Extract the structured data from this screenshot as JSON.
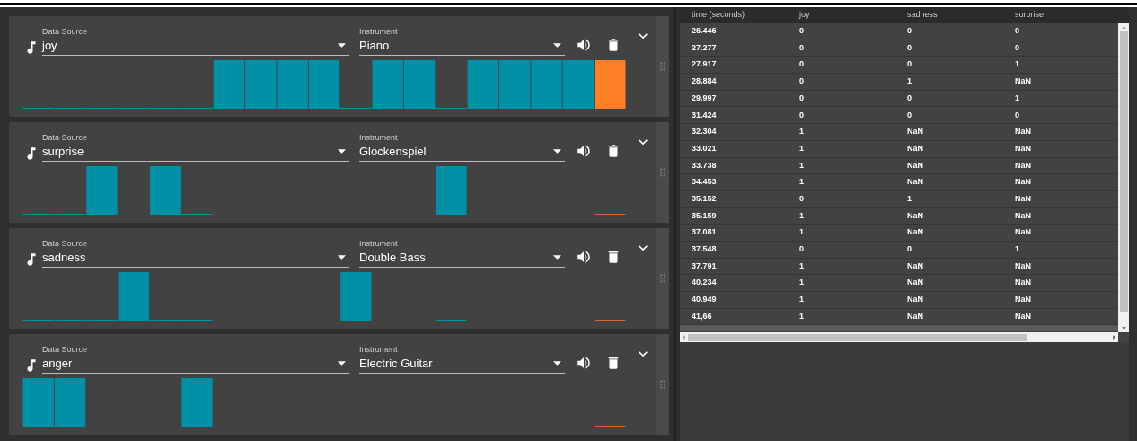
{
  "tracks": [
    {
      "data_source": {
        "label": "Data Source",
        "value": "joy"
      },
      "instrument": {
        "label": "Instrument",
        "value": "Piano"
      },
      "steps": [
        {
          "kind": "low"
        },
        {
          "kind": "low"
        },
        {
          "kind": "low"
        },
        {
          "kind": "low"
        },
        {
          "kind": "low"
        },
        {
          "kind": "low"
        },
        {
          "kind": "high"
        },
        {
          "kind": "high"
        },
        {
          "kind": "high"
        },
        {
          "kind": "high"
        },
        {
          "kind": "low"
        },
        {
          "kind": "high"
        },
        {
          "kind": "high"
        },
        {
          "kind": "low"
        },
        {
          "kind": "high"
        },
        {
          "kind": "high"
        },
        {
          "kind": "high"
        },
        {
          "kind": "high"
        },
        {
          "kind": "playhead-high"
        }
      ]
    },
    {
      "data_source": {
        "label": "Data Source",
        "value": "surprise"
      },
      "instrument": {
        "label": "Instrument",
        "value": "Glockenspiel"
      },
      "steps": [
        {
          "kind": "low"
        },
        {
          "kind": "low"
        },
        {
          "kind": "high"
        },
        {
          "kind": "empty"
        },
        {
          "kind": "high"
        },
        {
          "kind": "low"
        },
        {
          "kind": "empty"
        },
        {
          "kind": "empty"
        },
        {
          "kind": "empty"
        },
        {
          "kind": "empty"
        },
        {
          "kind": "empty"
        },
        {
          "kind": "empty"
        },
        {
          "kind": "empty"
        },
        {
          "kind": "high"
        },
        {
          "kind": "empty"
        },
        {
          "kind": "empty"
        },
        {
          "kind": "empty"
        },
        {
          "kind": "empty"
        },
        {
          "kind": "playhead-low"
        }
      ]
    },
    {
      "data_source": {
        "label": "Data Source",
        "value": "sadness"
      },
      "instrument": {
        "label": "Instrument",
        "value": "Double Bass"
      },
      "steps": [
        {
          "kind": "low"
        },
        {
          "kind": "low"
        },
        {
          "kind": "low"
        },
        {
          "kind": "high"
        },
        {
          "kind": "low"
        },
        {
          "kind": "low"
        },
        {
          "kind": "empty"
        },
        {
          "kind": "empty"
        },
        {
          "kind": "empty"
        },
        {
          "kind": "empty"
        },
        {
          "kind": "high"
        },
        {
          "kind": "empty"
        },
        {
          "kind": "empty"
        },
        {
          "kind": "low"
        },
        {
          "kind": "empty"
        },
        {
          "kind": "empty"
        },
        {
          "kind": "empty"
        },
        {
          "kind": "empty"
        },
        {
          "kind": "playhead-low"
        }
      ]
    },
    {
      "data_source": {
        "label": "Data Source",
        "value": "anger"
      },
      "instrument": {
        "label": "Instrument",
        "value": "Electric Guitar"
      },
      "steps": [
        {
          "kind": "high"
        },
        {
          "kind": "high"
        },
        {
          "kind": "empty"
        },
        {
          "kind": "empty"
        },
        {
          "kind": "empty"
        },
        {
          "kind": "high"
        },
        {
          "kind": "empty"
        },
        {
          "kind": "empty"
        },
        {
          "kind": "empty"
        },
        {
          "kind": "empty"
        },
        {
          "kind": "empty"
        },
        {
          "kind": "empty"
        },
        {
          "kind": "empty"
        },
        {
          "kind": "empty"
        },
        {
          "kind": "empty"
        },
        {
          "kind": "empty"
        },
        {
          "kind": "empty"
        },
        {
          "kind": "empty"
        },
        {
          "kind": "playhead-low"
        }
      ]
    }
  ],
  "table": {
    "columns": [
      "time (seconds)",
      "joy",
      "sadness",
      "surprise"
    ],
    "rows": [
      [
        "26.446",
        "0",
        "0",
        "0"
      ],
      [
        "27.277",
        "0",
        "0",
        "0"
      ],
      [
        "27.917",
        "0",
        "0",
        "1"
      ],
      [
        "28.884",
        "0",
        "1",
        "NaN"
      ],
      [
        "29.997",
        "0",
        "0",
        "1"
      ],
      [
        "31.424",
        "0",
        "0",
        "0"
      ],
      [
        "32.304",
        "1",
        "NaN",
        "NaN"
      ],
      [
        "33.021",
        "1",
        "NaN",
        "NaN"
      ],
      [
        "33.738",
        "1",
        "NaN",
        "NaN"
      ],
      [
        "34.453",
        "1",
        "NaN",
        "NaN"
      ],
      [
        "35.152",
        "0",
        "1",
        "NaN"
      ],
      [
        "35.159",
        "1",
        "NaN",
        "NaN"
      ],
      [
        "37.081",
        "1",
        "NaN",
        "NaN"
      ],
      [
        "37.548",
        "0",
        "0",
        "1"
      ],
      [
        "37.791",
        "1",
        "NaN",
        "NaN"
      ],
      [
        "40.234",
        "1",
        "NaN",
        "NaN"
      ],
      [
        "40.949",
        "1",
        "NaN",
        "NaN"
      ],
      [
        "41,66",
        "1",
        "NaN",
        "NaN"
      ]
    ]
  }
}
